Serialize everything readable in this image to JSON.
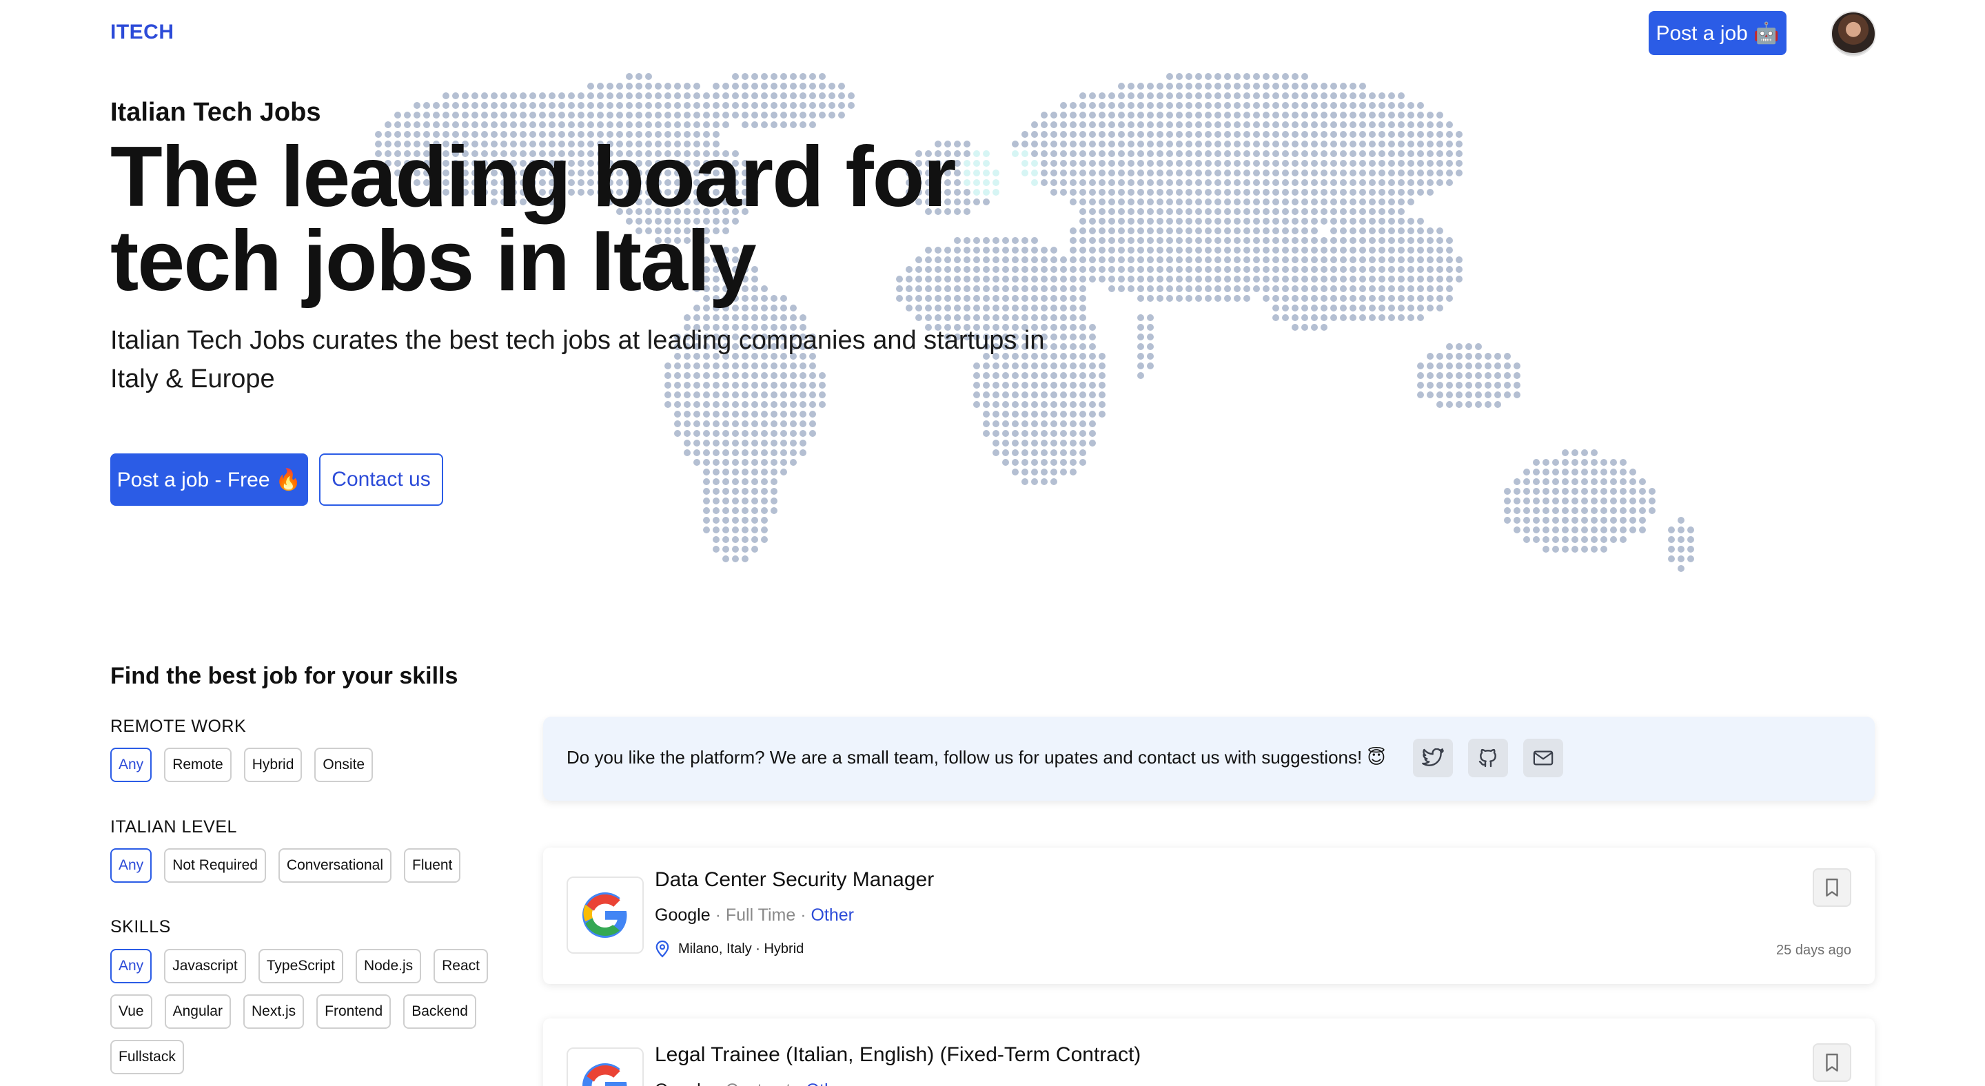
{
  "header": {
    "logo": "ITECH",
    "post_job_label": "Post a job 🤖"
  },
  "hero": {
    "eyebrow": "Italian Tech Jobs",
    "title": "The leading board for tech jobs in Italy",
    "subtitle": "Italian Tech Jobs curates the best tech jobs at leading companies and startups in Italy & Europe",
    "primary_button": "Post a job - Free 🔥",
    "secondary_button": "Contact us"
  },
  "filters": {
    "title": "Find the best job for your skills",
    "remote_work": {
      "heading": "REMOTE WORK",
      "options": [
        "Any",
        "Remote",
        "Hybrid",
        "Onsite"
      ],
      "selected": "Any"
    },
    "italian_level": {
      "heading": "ITALIAN LEVEL",
      "options": [
        "Any",
        "Not Required",
        "Conversational",
        "Fluent"
      ],
      "selected": "Any"
    },
    "skills": {
      "heading": "SKILLS",
      "options": [
        "Any",
        "Javascript",
        "TypeScript",
        "Node.js",
        "React",
        "Vue",
        "Angular",
        "Next.js",
        "Frontend",
        "Backend",
        "Fullstack"
      ],
      "selected": "Any"
    }
  },
  "banner": {
    "text": "Do you like the platform? We are a small team, follow us for upates and contact us with suggestions! 😇",
    "icons": [
      "twitter-icon",
      "github-icon",
      "mail-icon"
    ]
  },
  "jobs": [
    {
      "title": "Data Center Security Manager",
      "company": "Google",
      "type": "Full Time",
      "category": "Other",
      "location": "Milano, Italy · Hybrid",
      "age": "25 days ago"
    },
    {
      "title": "Legal Trainee (Italian, English) (Fixed-Term Contract)",
      "company": "Google",
      "type": "Contract",
      "category": "Other"
    }
  ],
  "colors": {
    "accent": "#2b5ce6",
    "map_dot": "#b4bfd2",
    "map_highlight": "#d6f5f4",
    "banner_bg": "#eef4fd"
  }
}
